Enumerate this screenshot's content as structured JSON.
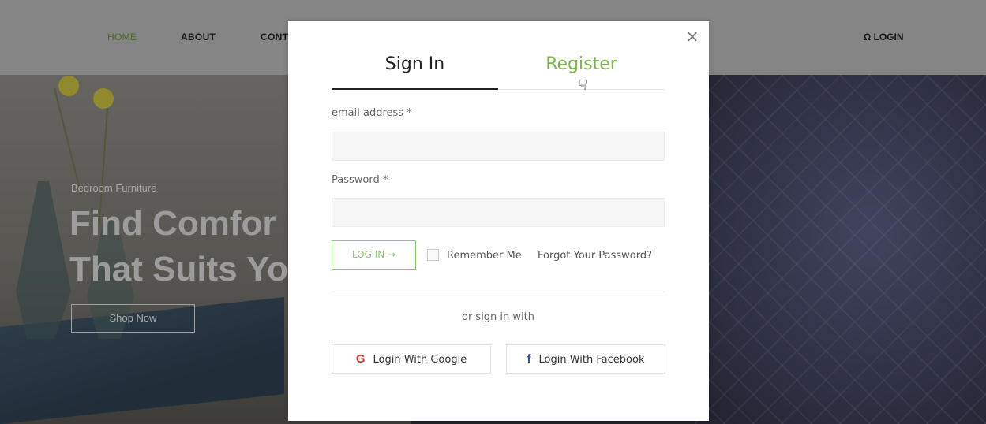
{
  "navbar": {
    "items": [
      "HOME",
      "ABOUT",
      "CONT"
    ],
    "login_label": "Ω LOGIN",
    "active_color": "#6b8f3a"
  },
  "hero": {
    "subtitle": "Bedroom Furniture",
    "title_line1": "Find Comfor",
    "title_line2": "That Suits Yo",
    "button_label": "Shop Now"
  },
  "modal": {
    "close_label": "×",
    "tabs": [
      {
        "label": "Sign In",
        "active": true
      },
      {
        "label": "Register",
        "active": false
      }
    ],
    "email_label": "email address *",
    "email_value": "",
    "password_label": "Password *",
    "password_value": "",
    "login_button": "LOG IN  →",
    "remember_label": "Remember Me",
    "remember_checked": false,
    "forgot_label": "Forgot Your Password?",
    "or_label": "or sign in with",
    "google_icon": "G",
    "google_label": "Login With Google",
    "facebook_icon": "f",
    "facebook_label": "Login With Facebook",
    "accent_color": "#7ab648"
  }
}
